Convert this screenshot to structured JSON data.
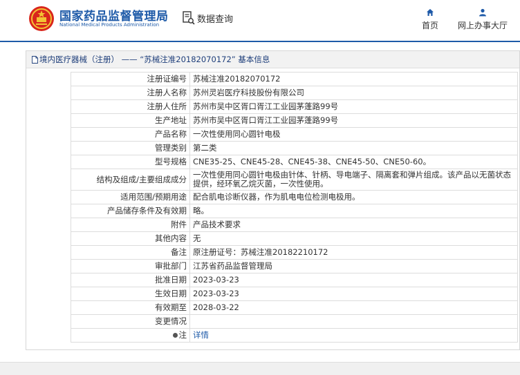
{
  "header": {
    "brand_cn": "国家药品监督管理局",
    "brand_en": "National Medical Products Administration",
    "query_label": "数据查询",
    "nav": [
      {
        "label": "首页",
        "icon": "home-icon"
      },
      {
        "label": "网上办事大厅",
        "icon": "user-icon"
      }
    ],
    "brand_color": "#1e5aa8"
  },
  "panel": {
    "title_parts": [
      "境内医疗器械（注册）",
      " —— “",
      "苏械注准20182070172",
      "”",
      " 基本信息"
    ]
  },
  "rows": [
    {
      "label": "注册证编号",
      "value": "苏械注准20182070172"
    },
    {
      "label": "注册人名称",
      "value": "苏州灵岩医疗科技股份有限公司"
    },
    {
      "label": "注册人住所",
      "value": "苏州市吴中区胥口胥江工业园茅蓬路99号"
    },
    {
      "label": "生产地址",
      "value": "苏州市吴中区胥口胥江工业园茅蓬路99号"
    },
    {
      "label": "产品名称",
      "value": "一次性使用同心圆针电极"
    },
    {
      "label": "管理类别",
      "value": "第二类"
    },
    {
      "label": "型号规格",
      "value": "CNE35-25、CNE45-28、CNE45-38、CNE45-50、CNE50-60。"
    },
    {
      "label": "结构及组成/主要组成成分",
      "value": "一次性使用同心圆针电极由针体、针柄、导电端子、隔离套和弹片组成。该产品以无菌状态提供，经环氧乙烷灭菌，一次性使用。"
    },
    {
      "label": "适用范围/预期用途",
      "value": "配合肌电诊断仪器，作为肌电电位检测电极用。"
    },
    {
      "label": "产品储存条件及有效期",
      "value": "略。"
    },
    {
      "label": "附件",
      "value": "产品技术要求"
    },
    {
      "label": "其他内容",
      "value": "无"
    },
    {
      "label": "备注",
      "value": "原注册证号：苏械注准20182210172"
    },
    {
      "label": "审批部门",
      "value": "江苏省药品监督管理局"
    },
    {
      "label": "批准日期",
      "value": "2023-03-23"
    },
    {
      "label": "生效日期",
      "value": "2023-03-23"
    },
    {
      "label": "有效期至",
      "value": "2028-03-22"
    },
    {
      "label": "变更情况",
      "value": ""
    },
    {
      "label": "注",
      "value": "详情"
    }
  ]
}
